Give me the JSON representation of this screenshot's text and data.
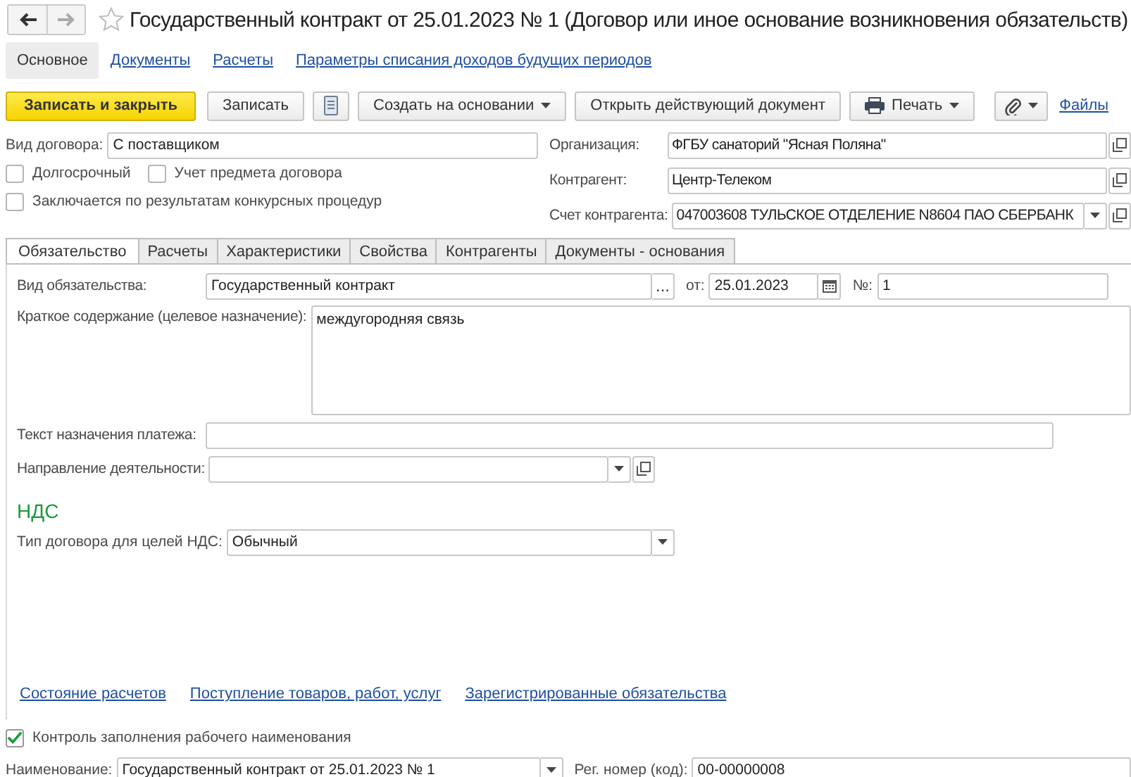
{
  "window": {
    "title": "Государственный контракт от 25.01.2023 № 1 (Договор или иное основание возникновения обязательств)"
  },
  "sections": [
    {
      "label": "Основное",
      "selected": true
    },
    {
      "label": "Документы",
      "selected": false
    },
    {
      "label": "Расчеты",
      "selected": false
    },
    {
      "label": "Параметры списания доходов будущих периодов",
      "selected": false
    }
  ],
  "toolbar": [
    {
      "kind": "primary",
      "label": "Записать и закрыть"
    },
    {
      "kind": "button",
      "label": "Записать"
    },
    {
      "kind": "list"
    },
    {
      "kind": "menu",
      "label": "Создать на основании"
    },
    {
      "kind": "button",
      "label": "Открыть действующий документ"
    },
    {
      "kind": "print",
      "label": "Печать"
    },
    {
      "kind": "attach"
    },
    {
      "kind": "link",
      "label": "Файлы"
    }
  ],
  "header": {
    "contract_type": {
      "label": "Вид договора:",
      "value": "С поставщиком"
    },
    "checkbox_rows": [
      [
        {
          "label": "Долгосрочный",
          "checked": false
        },
        {
          "label": "Учет предмета договора",
          "checked": false
        }
      ],
      [
        {
          "label": "Заключается по результатам конкурсных процедур",
          "checked": false
        }
      ]
    ],
    "organization": {
      "label": "Организация:",
      "value": "ФГБУ санаторий \"Ясная Поляна\"",
      "buttons": [
        {
          "kind": "open"
        }
      ]
    },
    "counterparty": {
      "label": "Контрагент:",
      "value": "Центр-Телеком",
      "buttons": [
        {
          "kind": "open"
        }
      ]
    },
    "account": {
      "label": "Счет контрагента:",
      "value": "047003608 ТУЛЬСКОЕ ОТДЕЛЕНИЕ N8604 ПАО СБЕРБАНК",
      "buttons": [
        {
          "kind": "dropdown"
        },
        {
          "kind": "open"
        }
      ]
    }
  },
  "tabs": [
    {
      "label": "Обязательство",
      "selected": true
    },
    {
      "label": "Расчеты",
      "selected": false
    },
    {
      "label": "Характеристики",
      "selected": false
    },
    {
      "label": "Свойства",
      "selected": false
    },
    {
      "label": "Контрагенты",
      "selected": false
    },
    {
      "label": "Документы - основания",
      "selected": false
    }
  ],
  "obligation": {
    "kind_field": {
      "label": "Вид обязательства:",
      "value": "Государственный контракт",
      "buttons": [
        {
          "kind": "choose",
          "text": "..."
        }
      ]
    },
    "date_field": {
      "label": "от:",
      "value": "25.01.2023",
      "buttons": [
        {
          "kind": "calendar"
        }
      ]
    },
    "number_field": {
      "label": "№:",
      "value": "1"
    },
    "summary": {
      "label": "Краткое содержание (целевое назначение):",
      "value": "междугородняя связь"
    },
    "payment_text": {
      "label": "Текст назначения платежа:"
    },
    "activity": {
      "label": "Направление деятельности:",
      "buttons": [
        {
          "kind": "dropdown"
        },
        {
          "kind": "open"
        }
      ]
    },
    "vat_heading": "НДС",
    "vat_type": {
      "label": "Тип договора для целей НДС:",
      "value": "Обычный",
      "buttons": [
        {
          "kind": "dropdown"
        }
      ]
    },
    "links": [
      "Состояние расчетов",
      "Поступление товаров, работ, услуг",
      "Зарегистрированные обязательства"
    ]
  },
  "name_check": {
    "label": "Контроль заполнения рабочего наименования",
    "checked": true
  },
  "name_field": {
    "label": "Наименование:",
    "value": "Государственный контракт от 25.01.2023 № 1",
    "buttons": [
      {
        "kind": "dropdown"
      }
    ]
  },
  "reg_number": {
    "label": "Рег. номер (код):",
    "value": "00-00000008"
  }
}
